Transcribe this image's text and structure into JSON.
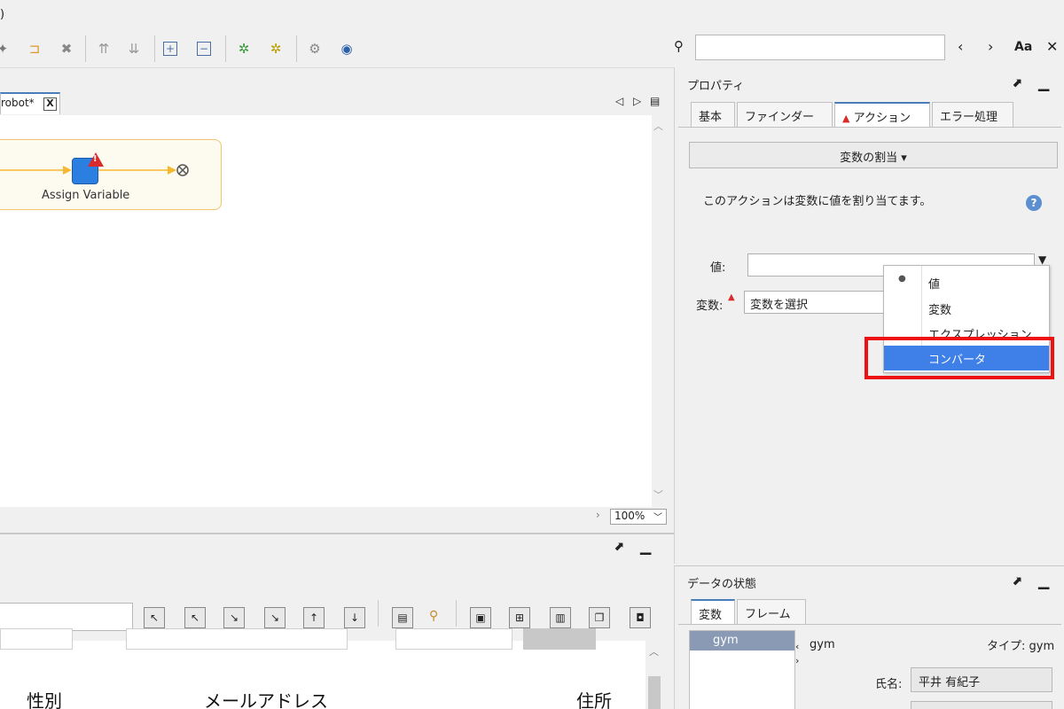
{
  "title": ")",
  "search": {
    "placeholder": "",
    "value": "",
    "prev": "‹",
    "next": "›",
    "match_case": "Aa",
    "close": "✕"
  },
  "editor": {
    "tab_label": "robot*",
    "tab_close": "X",
    "step_label": "Assign Variable",
    "zoom": "100%"
  },
  "bottom": {
    "columns": [
      "性別",
      "メールアドレス",
      "住所"
    ]
  },
  "properties": {
    "title": "プロパティ",
    "tabs": [
      "基本",
      "ファインダー",
      "アクション",
      "エラー処理"
    ],
    "active_tab": "アクション",
    "action_button": "変数の割当 ▾",
    "description": "このアクションは変数に値を割り当てます。",
    "value_label": "値:",
    "variable_label": "変数:",
    "variable_select": "変数を選択",
    "dropdown_items": [
      "値",
      "変数",
      "エクスプレッション",
      "コンバータ"
    ],
    "selected_item": "コンバータ"
  },
  "data_state": {
    "title": "データの状態",
    "tabs": [
      "変数",
      "フレーム"
    ],
    "variables": [
      "gym"
    ],
    "current_var": "gym",
    "type_label": "タイプ: gym",
    "name_label": "氏名:",
    "name_value": "平井 有紀子"
  },
  "colors": {
    "accent": "#3f7fe8",
    "highlight": "#ee1111",
    "flow_border": "#f0c36d"
  }
}
